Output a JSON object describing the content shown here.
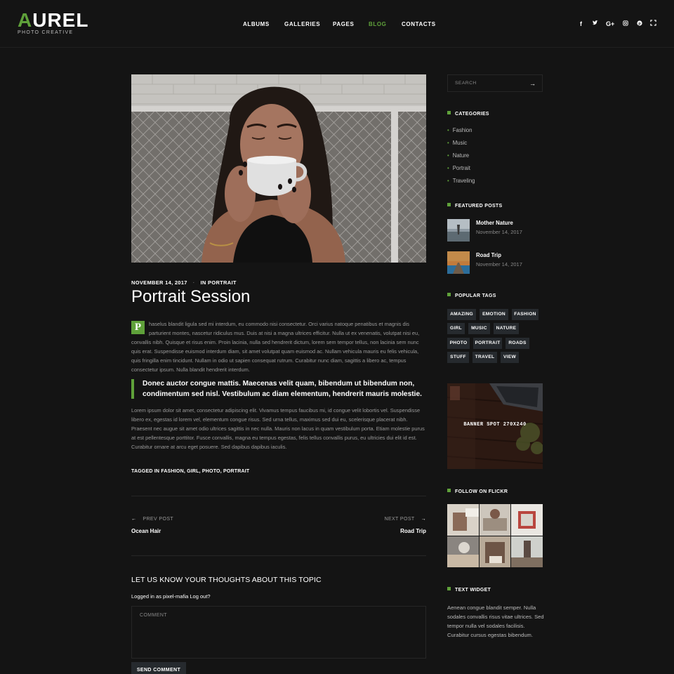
{
  "logo": {
    "accent_letter": "A",
    "rest": "UREL",
    "subtitle": "PHOTO CREATIVE"
  },
  "nav": {
    "items": [
      {
        "label": "ALBUMS",
        "active": false
      },
      {
        "label": "GALLERIES",
        "active": false
      },
      {
        "label": "PAGES",
        "active": false
      },
      {
        "label": "BLOG",
        "active": true
      },
      {
        "label": "CONTACTS",
        "active": false
      }
    ]
  },
  "social": [
    "facebook-icon",
    "twitter-icon",
    "google-plus-icon",
    "instagram-icon",
    "pinterest-icon",
    "fullscreen-icon"
  ],
  "post": {
    "date": "NOVEMBER 14, 2017",
    "dot": "·",
    "category": "IN PORTRAIT",
    "title": "Portrait Session",
    "dropcap": "P",
    "para1": "haselus blandit ligula sed mi interdum, eu commodo nisi consectetur. Orci varius natoque penatibus et magnis dis parturient montes, nascetur ridiculus mus. Duis at nisi a magna ultrices efficitur. Nulla ut ex venenatis, volutpat nisi eu, convallis nibh. Quisque et risus enim. Proin lacinia, nulla sed hendrerit dictum, lorem sem tempor tellus, non lacinia sem nunc quis erat. Suspendisse euismod interdum diam, sit amet volutpat quam euismod ac. Nullam vehicula mauris eu felis vehicula, quis fringilla enim tincidunt. Nullam in odio ut sapien consequat rutrum. Curabitur nunc diam, sagittis a libero ac, tempus consectetur ipsum. Nulla blandit hendrerit interdum.",
    "quote": "Donec auctor congue mattis. Maecenas velit quam, bibendum ut bibendum non, condimentum sed nisl. Vestibulum ac diam elementum, hendrerit mauris molestie.",
    "para2": "Lorem ipsum dolor sit amet, consectetur adipiscing elit. Vivamus tempus faucibus mi, id congue velit lobortis vel. Suspendisse libero ex, egestas id lorem vel, elementum congue risus. Sed urna tellus, maximus sed dui eu, scelerisque placerat nibh. Praesent nec augue sit amet odio ultrices sagittis in nec nulla. Mauris non lacus in quam vestibulum porta. Etiam molestie purus at est pellentesque porttitor. Fusce convallis, magna eu tempus egestas, felis tellus convallis purus, eu ultricies dui elit id est. Curabitur ornare at arcu eget posuere. Sed dapibus dapibus iaculis.",
    "tagged": "TAGGED IN FASHION, GIRL, PHOTO, PORTRAIT"
  },
  "navigation": {
    "prev_label": "PREV POST",
    "prev_title": "Ocean Hair",
    "next_label": "NEXT POST",
    "next_title": "Road Trip"
  },
  "comments": {
    "heading": "LET US KNOW YOUR THOUGHTS ABOUT THIS TOPIC",
    "logged_in": "Logged in as pixel-mafia  Log out?",
    "placeholder": "COMMENT",
    "send_label": "SEND COMMENT"
  },
  "sidebar": {
    "search_placeholder": "SEARCH",
    "categories_title": "CATEGORIES",
    "categories": [
      "Fashion",
      "Music",
      "Nature",
      "Portrait",
      "Traveling"
    ],
    "featured_title": "FEATURED POSTS",
    "featured": [
      {
        "title": "Mother Nature",
        "date": "November 14, 2017"
      },
      {
        "title": "Road Trip",
        "date": "November 14, 2017"
      }
    ],
    "tags_title": "POPULAR TAGS",
    "tags": [
      "AMAZING",
      "EMOTION",
      "FASHION",
      "GIRL",
      "MUSIC",
      "NATURE",
      "PHOTO",
      "PORTRAIT",
      "ROADS",
      "STUFF",
      "TRAVEL",
      "VIEW"
    ],
    "banner_label": "BANNER SPOT 270X240",
    "flickr_title": "FOLLOW ON FLICKR",
    "text_widget_title": "TEXT WIDGET",
    "text_widget_body": "Aenean congue blandit semper. Nulla sodales convallis risus vitae ultrices. Sed tempor nulla vel sodales facilisis. Curabitur cursus egestas bibendum."
  },
  "colors": {
    "accent": "#5fa13a",
    "background": "#141414",
    "tag_bg": "#262a2e"
  }
}
